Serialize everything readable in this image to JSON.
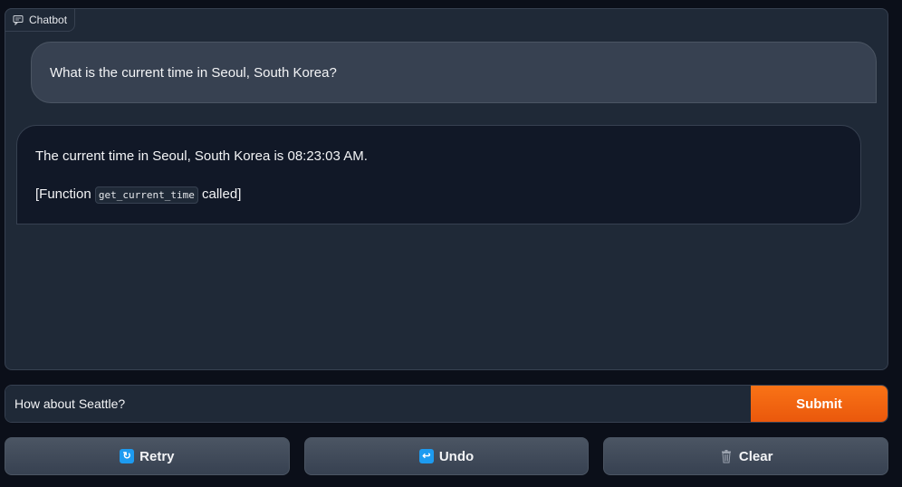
{
  "chatbot": {
    "label": "Chatbot",
    "icon": "chat-icon",
    "messages": [
      {
        "role": "user",
        "text": "What is the current time in Seoul, South Korea?"
      },
      {
        "role": "bot",
        "line1": "The current time in Seoul, South Korea is 08:23:03 AM.",
        "fn_prefix": "[Function ",
        "fn_name": "get_current_time",
        "fn_suffix": " called]"
      }
    ]
  },
  "input": {
    "value": "How about Seattle?",
    "submit_label": "Submit"
  },
  "actions": {
    "retry": {
      "label": "Retry",
      "icon": "retry-icon"
    },
    "undo": {
      "label": "Undo",
      "icon": "undo-icon"
    },
    "clear": {
      "label": "Clear",
      "icon": "trash-icon"
    }
  },
  "colors": {
    "accent": "#f97316",
    "panel": "#1f2937",
    "background": "#0b0f19"
  }
}
